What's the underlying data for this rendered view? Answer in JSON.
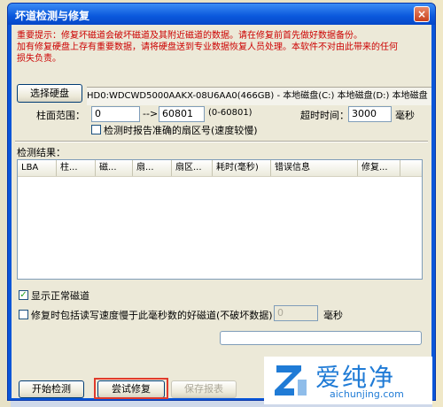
{
  "window": {
    "title": "坏道检测与修复",
    "close_glyph": "×"
  },
  "warning": {
    "line1": "重要提示：修复坏磁道会破坏磁道及其附近磁道的数据。请在修复前首先做好数据备份。",
    "line2": "加有修复硬盘上存有重要数据，请将硬盘送到专业数据恢复人员处理。本软件不对由此带来的任何",
    "line3": "损失负责。"
  },
  "disk": {
    "select_button": "选择硬盘",
    "info": "HD0:WDCWD5000AAKX-08U6AA0(466GB) - 本地磁盘(C:) 本地磁盘(D:) 本地磁盘"
  },
  "range": {
    "label": "柱面范围：",
    "start": "0",
    "arrow": "-->",
    "end": "60801",
    "hint": "(0-60801)",
    "timeout_label": "超时时间：",
    "timeout": "3000",
    "timeout_unit": "毫秒",
    "exact_sector_label": "检测时报告准确的扇区号(速度较慢)"
  },
  "results": {
    "label": "检测结果：",
    "columns": [
      "LBA",
      "柱...",
      "磁...",
      "扇...",
      "扇区...",
      "耗时(毫秒)",
      "错误信息",
      "修复..."
    ]
  },
  "options": {
    "show_normal_label": "显示正常磁道",
    "show_normal_checked": true,
    "include_slow_label": "修复时包括读写速度慢于此毫秒数的好磁道(不破坏数据)：",
    "include_slow_checked": false,
    "slow_ms": "0",
    "slow_unit": "毫秒"
  },
  "progress": {
    "value": 0
  },
  "buttons": {
    "start": "开始检测",
    "repair": "尝试修复",
    "save": "保存报表"
  },
  "watermark": {
    "brand": "爱纯净",
    "url": "aichunjing.com"
  },
  "colors": {
    "title_blue": "#0a58dc",
    "warning_red": "#cc0000",
    "highlight_red": "#e03b2c",
    "brand_blue": "#1f7bd6"
  }
}
